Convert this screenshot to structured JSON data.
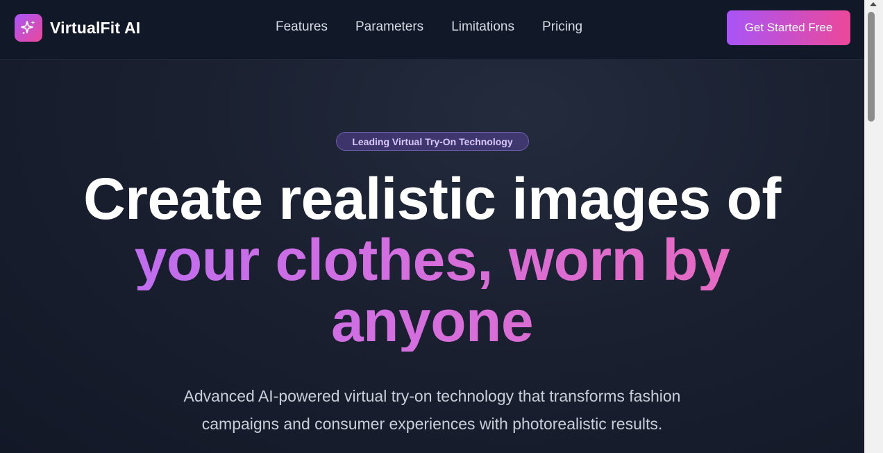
{
  "brand": {
    "name": "VirtualFit AI",
    "icon": "sparkles-icon"
  },
  "nav": {
    "links": [
      "Features",
      "Parameters",
      "Limitations",
      "Pricing"
    ]
  },
  "cta": {
    "label": "Get Started Free"
  },
  "hero": {
    "badge": "Leading Virtual Try-On Technology",
    "headline_line1": "Create realistic images of",
    "headline_line2": "your clothes, worn by",
    "headline_line3": "anyone",
    "subtitle_line1": "Advanced AI-powered virtual try-on technology that transforms fashion",
    "subtitle_line2": "campaigns and consumer experiences with photorealistic results."
  },
  "colors": {
    "background": "#1a2030",
    "header": "#111827",
    "accent_start": "#a855f7",
    "accent_end": "#ec4899"
  }
}
